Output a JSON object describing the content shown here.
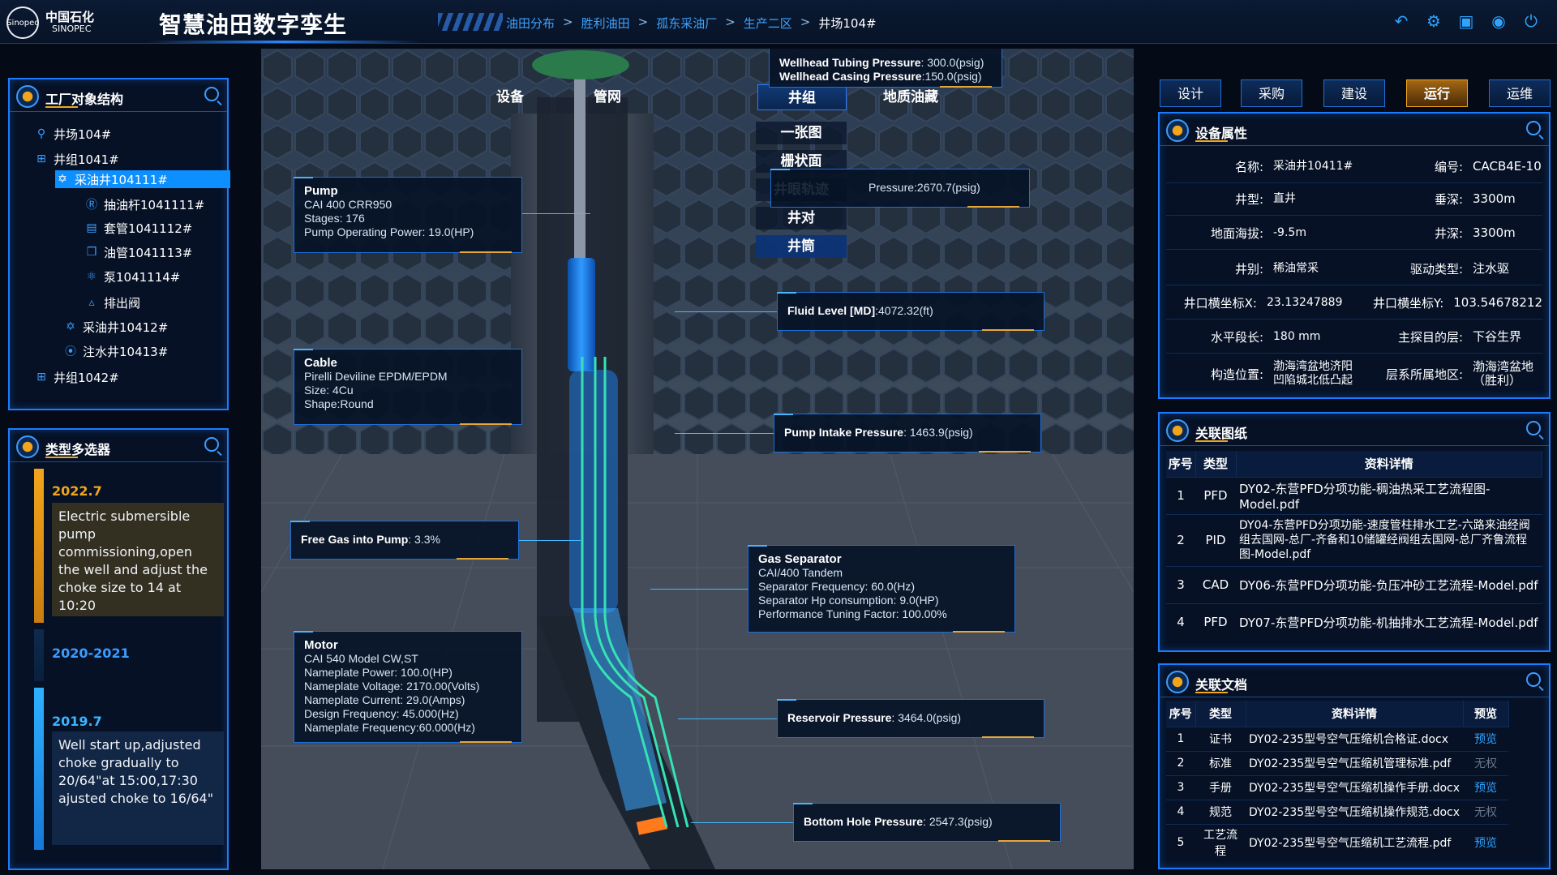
{
  "header": {
    "logo_cn": "中国石化",
    "logo_en": "SINOPEC",
    "logo_mark": "Sinopec",
    "app_title": "智慧油田数字孪生",
    "breadcrumb": [
      "油田分布",
      "胜利油田",
      "孤东采油厂",
      "生产二区",
      "井场104#"
    ],
    "icons": [
      "back-arrow-icon",
      "gear-icon",
      "shirt-icon",
      "user-icon",
      "power-icon"
    ]
  },
  "plant_tree": {
    "title": "工厂对象结构",
    "items": [
      {
        "label": "井场104#",
        "icon": "site-icon"
      },
      {
        "label": "井组1041#",
        "icon": "grid-icon"
      },
      {
        "label": "采油井104111#",
        "icon": "pump-jack-icon",
        "selected": true
      },
      {
        "label": "抽油杆1041111#",
        "icon": "rod-icon"
      },
      {
        "label": "套管1041112#",
        "icon": "casing-icon"
      },
      {
        "label": "油管1041113#",
        "icon": "tubing-icon"
      },
      {
        "label": "泵1041114#",
        "icon": "pump-icon"
      },
      {
        "label": "排出阀",
        "icon": "valve-icon"
      },
      {
        "label": "采油井10412#",
        "icon": "pump-jack-icon"
      },
      {
        "label": "注水井10413#",
        "icon": "injection-icon"
      },
      {
        "label": "井组1042#",
        "icon": "grid-icon"
      }
    ]
  },
  "type_selector": {
    "title": "类型多选器",
    "events": [
      {
        "year": "2022.7",
        "text": "Electric submersible pump commissioning,open the well and adjust the choke size to 14 at 10:20"
      },
      {
        "year": "2020-2021",
        "text": ""
      },
      {
        "year": "2019.7",
        "text": "Well start up,adjusted choke gradually to 20/64\"at 15:00,17:30 ajusted choke to 16/64\""
      }
    ]
  },
  "viewport": {
    "tabs": [
      "设备",
      "管网",
      "井组",
      "地质油藏"
    ],
    "active_tab": "井组",
    "submenu": [
      "一张图",
      "栅状面",
      "井眼轨迹",
      "井对",
      "井筒"
    ],
    "active_submenu": "井筒",
    "callouts": {
      "wellhead": {
        "tubing_label": "Wellhead Tubing Pressure",
        "tubing_value": ": 300.0(psig)",
        "casing_label": "Wellhead Casing Pressure",
        "casing_value": ":150.0(psig)"
      },
      "discharge": {
        "value": "Pressure:2670.7(psig)"
      },
      "pump": {
        "title": "Pump",
        "model": "CAI 400 CRR950",
        "stages": "Stages: 176",
        "power": "Pump Operating Power:  19.0(HP)"
      },
      "fluid_level": {
        "label": "Fluid Level [MD]",
        "value": ":4072.32(ft)"
      },
      "cable": {
        "title": "Cable",
        "model": "Pirelli Deviline EPDM/EPDM",
        "size": "Size:  4Cu",
        "shape": "Shape:Round"
      },
      "pump_intake": {
        "label": "Pump Intake Pressure",
        "value": ": 1463.9(psig)"
      },
      "free_gas": {
        "label": "Free Gas into Pump",
        "value": ": 3.3%"
      },
      "gas_separator": {
        "title": "Gas Separator",
        "model": "CAI/400 Tandem",
        "freq": "Separator Frequency: 60.0(Hz)",
        "hp": "Separator Hp consumption: 9.0(HP)",
        "perf": "Performance Tuning Factor: 100.00%"
      },
      "motor": {
        "title": "Motor",
        "model": "CAI 540 Model CW,ST",
        "power": "Nameplate Power: 100.0(HP)",
        "voltage": "Nameplate Voltage: 2170.00(Volts)",
        "current": "Nameplate Current: 29.0(Amps)",
        "design_freq": "Design Frequency: 45.000(Hz)",
        "np_freq": "Nameplate Frequency:60.000(Hz)"
      },
      "reservoir": {
        "label": "Reservoir Pressure",
        "value": ": 3464.0(psig)"
      },
      "bottom_hole": {
        "label": "Bottom Hole Pressure",
        "value": ": 2547.3(psig)"
      }
    }
  },
  "right_tabs": {
    "items": [
      "设计",
      "采购",
      "建设",
      "运行",
      "运维"
    ],
    "active": "运行"
  },
  "device_props": {
    "title": "设备属性",
    "rows": [
      {
        "l1": "名称:",
        "v1": "采油井10411#",
        "l2": "编号:",
        "v2": "CACB4E-10"
      },
      {
        "l1": "井型:",
        "v1": "直井",
        "l2": "垂深:",
        "v2": "3300m"
      },
      {
        "l1": "地面海拔:",
        "v1": "-9.5m",
        "l2": "井深:",
        "v2": "3300m"
      },
      {
        "l1": "井别:",
        "v1": "稀油常采",
        "l2": "驱动类型:",
        "v2": "注水驱"
      },
      {
        "l1": "井口横坐标X:",
        "v1": "23.13247889",
        "l2": "井口横坐标Y:",
        "v2": "103.54678212"
      },
      {
        "l1": "水平段长:",
        "v1": "180 mm",
        "l2": "主探目的层:",
        "v2": "下谷生界"
      },
      {
        "l1": "构造位置:",
        "v1": "渤海湾盆地济阳凹陷城北低凸起",
        "l2": "层系所属地区:",
        "v2": "渤海湾盆地（胜利）"
      }
    ]
  },
  "drawings": {
    "title": "关联图纸",
    "columns": [
      "序号",
      "类型",
      "资料详情"
    ],
    "rows": [
      {
        "no": "1",
        "type": "PFD",
        "detail": "DY02-东营PFD分项功能-稠油热采工艺流程图-Model.pdf"
      },
      {
        "no": "2",
        "type": "PID",
        "detail": "DY04-东营PFD分项功能-速度管柱排水工艺-六路来油经阀组去国网-总厂-齐备和10储罐经阀组去国网-总厂齐鲁流程图-Model.pdf"
      },
      {
        "no": "3",
        "type": "CAD",
        "detail": "DY06-东营PFD分项功能-负压冲砂工艺流程-Model.pdf"
      },
      {
        "no": "4",
        "type": "PFD",
        "detail": "DY07-东营PFD分项功能-机抽排水工艺流程-Model.pdf"
      }
    ]
  },
  "documents": {
    "title": "关联文档",
    "columns": [
      "序号",
      "类型",
      "资料详情",
      "预览"
    ],
    "rows": [
      {
        "no": "1",
        "type": "证书",
        "detail": "DY02-235型号空气压缩机合格证.docx",
        "preview": "预览",
        "enabled": true
      },
      {
        "no": "2",
        "type": "标准",
        "detail": "DY02-235型号空气压缩机管理标准.pdf",
        "preview": "无权",
        "enabled": false
      },
      {
        "no": "3",
        "type": "手册",
        "detail": "DY02-235型号空气压缩机操作手册.docx",
        "preview": "预览",
        "enabled": true
      },
      {
        "no": "4",
        "type": "规范",
        "detail": "DY02-235型号空气压缩机操作规范.docx",
        "preview": "无权",
        "enabled": false
      },
      {
        "no": "5",
        "type": "工艺流程",
        "detail": "DY02-235型号空气压缩机工艺流程.pdf",
        "preview": "预览",
        "enabled": true
      }
    ]
  },
  "colors": {
    "accent": "#1b7cff",
    "active_tab": "#f2a51b",
    "link": "#2fa4ff",
    "tube": "#1f7ae0",
    "cable": "#36e2b5"
  }
}
